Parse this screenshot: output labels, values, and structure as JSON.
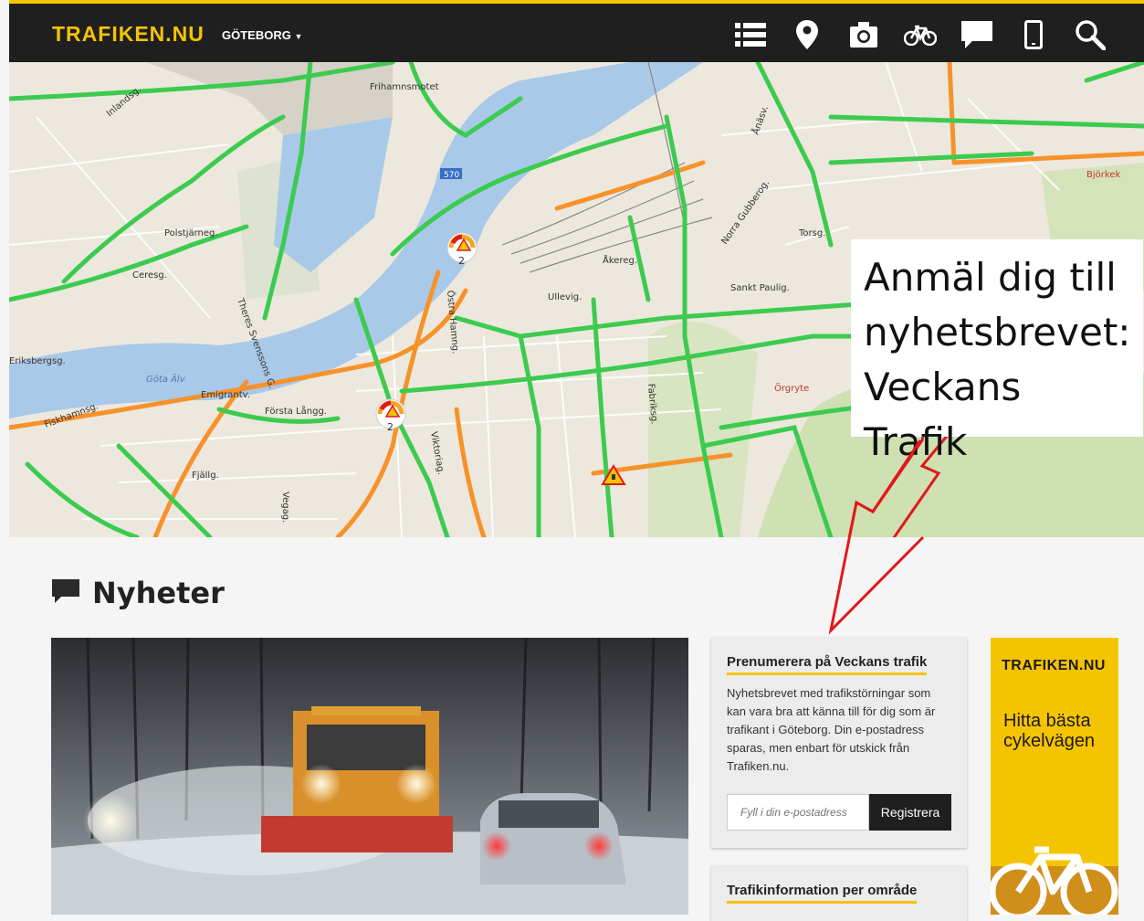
{
  "header": {
    "logo": "TRAFIKEN.NU",
    "city": "GÖTEBORG",
    "nav_icons": [
      "list-icon",
      "location-pin-icon",
      "camera-icon",
      "bicycle-icon",
      "chat-icon",
      "phone-icon",
      "search-icon"
    ]
  },
  "map": {
    "callout": "Anmäl dig till nyhetsbrevet: Veckans Trafik",
    "labels": [
      "Frihamnsmotet",
      "Polstjärneg.",
      "Ceresg.",
      "Theres Svenssons G.",
      "Östra Hamng.",
      "Åkereg.",
      "Ullevig.",
      "Sankt Paulig.",
      "Torsg.",
      "Norra Gubberog.",
      "Örgryte",
      "Första Långg.",
      "Emigrantv.",
      "Göta Älv",
      "Viktoriag.",
      "Fjällg.",
      "Vegag.",
      "Fabriksg.",
      "Björkek",
      "570",
      "Ånäsv.",
      "Inlandsg.",
      "Eriksbergsg.",
      "Fiskhamnsg."
    ],
    "incident_counts": [
      "2",
      "2"
    ]
  },
  "news": {
    "heading": "Nyheter"
  },
  "subscribe": {
    "title": "Prenumerera på Veckans trafik",
    "body": "Nyhetsbrevet med trafikstörningar som kan vara bra att känna till för dig som är trafikant i Göteborg. Din e-postadress sparas, men enbart för utskick från Trafiken.nu.",
    "placeholder": "Fyll i din e-postadress",
    "button": "Registrera"
  },
  "areas": {
    "title": "Trafikinformation per område"
  },
  "ad": {
    "logo": "TRAFIKEN.NU",
    "text": "Hitta bästa cykelvägen"
  },
  "colors": {
    "accent": "#f5c400",
    "header_bg": "#1f1f1f",
    "road_green": "#3ccb4f",
    "road_orange": "#f7922b",
    "annotation_red": "#e0191c"
  }
}
